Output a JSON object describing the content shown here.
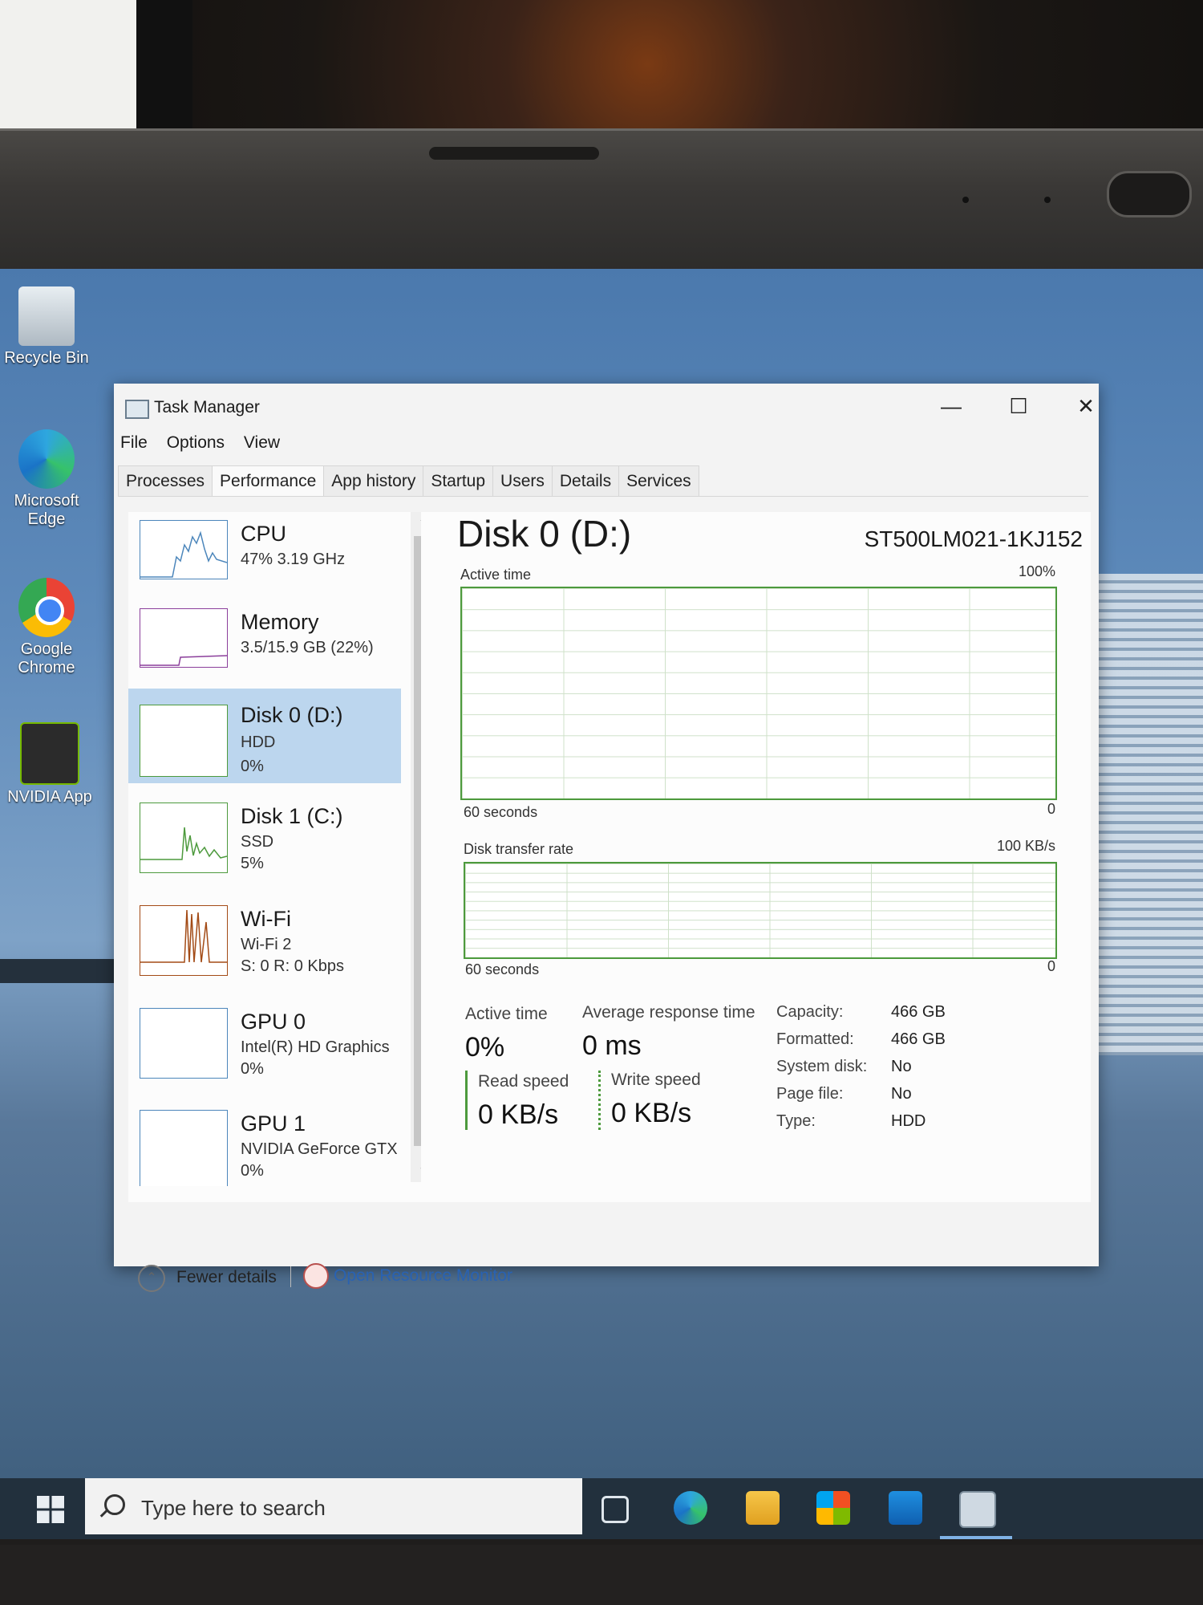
{
  "desktop": {
    "icons": [
      {
        "label": "Recycle Bin",
        "icon": "recycle-bin-icon"
      },
      {
        "label": "Microsoft Edge",
        "icon": "edge-icon"
      },
      {
        "label": "Google Chrome",
        "icon": "chrome-icon"
      },
      {
        "label": "NVIDIA App",
        "icon": "nvidia-icon"
      }
    ]
  },
  "window": {
    "title": "Task Manager",
    "controls": {
      "minimize": "—",
      "maximize": "☐",
      "close": "✕"
    }
  },
  "menu": [
    "File",
    "Options",
    "View"
  ],
  "tabs": [
    "Processes",
    "Performance",
    "App history",
    "Startup",
    "Users",
    "Details",
    "Services"
  ],
  "active_tab": "Performance",
  "sidebar": {
    "items": [
      {
        "name": "CPU",
        "line1": "47% 3.19 GHz",
        "line2": "",
        "graph_color": "#4c86bb"
      },
      {
        "name": "Memory",
        "line1": "3.5/15.9 GB (22%)",
        "line2": "",
        "graph_color": "#8b3f9b"
      },
      {
        "name": "Disk 0 (D:)",
        "line1": "HDD",
        "line2": "0%",
        "graph_color": "#4d9a3d"
      },
      {
        "name": "Disk 1 (C:)",
        "line1": "SSD",
        "line2": "5%",
        "graph_color": "#4d9a3d"
      },
      {
        "name": "Wi-Fi",
        "line1": "Wi-Fi 2",
        "line2": "S: 0 R: 0 Kbps",
        "graph_color": "#a34b16"
      },
      {
        "name": "GPU 0",
        "line1": "Intel(R) HD Graphics",
        "line2": "0%",
        "graph_color": "#4c86bb"
      },
      {
        "name": "GPU 1",
        "line1": "NVIDIA GeForce GTX",
        "line2": "0%",
        "graph_color": "#4c86bb"
      }
    ],
    "selected": "Disk 0 (D:)"
  },
  "detail": {
    "title": "Disk 0 (D:)",
    "model": "ST500LM021-1KJ152",
    "active_time_graph": {
      "label": "Active time",
      "max": "100%",
      "x_label": "60 seconds",
      "min": "0"
    },
    "transfer_graph": {
      "label": "Disk transfer rate",
      "max": "100 KB/s",
      "x_label": "60 seconds",
      "min": "0"
    },
    "stats": {
      "active_time_label": "Active time",
      "active_time_value": "0%",
      "avg_response_label": "Average response time",
      "avg_response_value": "0 ms",
      "read_label": "Read speed",
      "read_value": "0 KB/s",
      "write_label": "Write speed",
      "write_value": "0 KB/s"
    },
    "properties": [
      {
        "key": "Capacity:",
        "value": "466 GB"
      },
      {
        "key": "Formatted:",
        "value": "466 GB"
      },
      {
        "key": "System disk:",
        "value": "No"
      },
      {
        "key": "Page file:",
        "value": "No"
      },
      {
        "key": "Type:",
        "value": "HDD"
      }
    ]
  },
  "footer": {
    "fewer_details": "Fewer details",
    "resource_monitor": "Open Resource Monitor"
  },
  "taskbar": {
    "search_placeholder": "Type here to search",
    "pinned": [
      "task-view-icon",
      "edge-icon",
      "file-explorer-icon",
      "store-icon",
      "outlook-icon",
      "task-manager-icon"
    ]
  },
  "colors": {
    "accent": "#4d9a3d",
    "selection": "#bcd6ee",
    "link": "#2962b2"
  }
}
